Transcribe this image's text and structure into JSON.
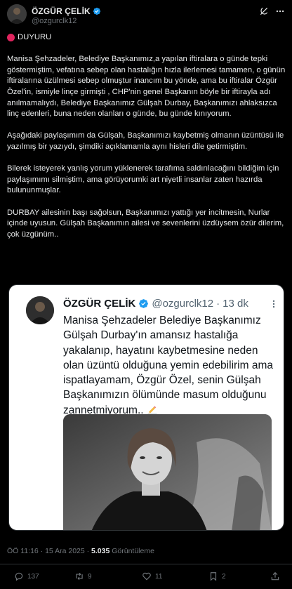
{
  "author": {
    "name": "ÖZGÜR ÇELİK",
    "handle": "@ozgurclk12"
  },
  "tweet": {
    "paragraphs": [
      "DUYURU",
      "Manisa Şehzadeler, Belediye Başkanımız,a yapılan iftiralara o günde tepki göstermiştim,  vefatına sebep olan hastalığın hızla ilerlemesi tamamen, o günün iftiralarına üzülmesi sebep olmuştur inancım bu yönde, ama bu iftiralar Özgür Özel'in, ismiyle linçe girmişti , CHP'nin genel Başkanın böyle bir iftirayla adı anılmamalıydı, Belediye Başkanımız Gülşah Durbay, Başkanımızı ahlaksızca linç edenleri, buna neden olanları o günde, bu günde kınıyorum.",
      "Aşağıdaki paylaşımım da Gülşah, Başkanımızı kaybetmiş olmanın üzüntüsü ile yazılmış bir yazıydı, şimdiki açıklamamla aynı hisleri dile getirmiştim.",
      "Bilerek isteyerek yanlış yorum yüklenerek tarafıma saldırılacağını bildiğim için paylaşımımı silmiştim, ama görüyorumki art niyetli insanlar zaten hazırda bulununmuşlar.",
      "DURBAY ailesinin başı sağolsun, Başkanımızı yattığı yer incitmesin, Nurlar içinde uyusun. Gülşah Başkanımın ailesi ve sevenlerini üzdüysem özür dilerim, çok üzgünüm.."
    ]
  },
  "quote": {
    "name": "ÖZGÜR ÇELİK",
    "handle": "@ozgurclk12",
    "dot": "·",
    "time": "13 dk",
    "text": "Manisa Şehzadeler Belediye Başkanımız Gülşah Durbay'ın amansız hastalığa yakalanıp, hayatını kaybetmesine neden olan üzüntü olduğuna yemin edebilirim ama ispatlayamam, Özgür Özel, senin Gülşah Başkanımızın ölümünde masum olduğunu zannetmiyorum.."
  },
  "meta": {
    "time_date": "ÖÖ 11:16 · 15 Ara 2025 · ",
    "views": "5.035",
    "views_label": " Görüntüleme"
  },
  "actions": {
    "replies": "137",
    "reposts": "9",
    "likes": "11",
    "bookmarks": "2"
  },
  "colors": {
    "background": "#000000",
    "text": "#e7e9ea",
    "muted": "#71767b",
    "verified": "#1d9bf0",
    "announce": "#e0245e"
  },
  "icons": [
    "grok-icon",
    "more-icon",
    "verified-icon",
    "red-circle-icon",
    "pencil-icon",
    "reply-icon",
    "repost-icon",
    "like-icon",
    "bookmark-icon",
    "share-icon"
  ]
}
